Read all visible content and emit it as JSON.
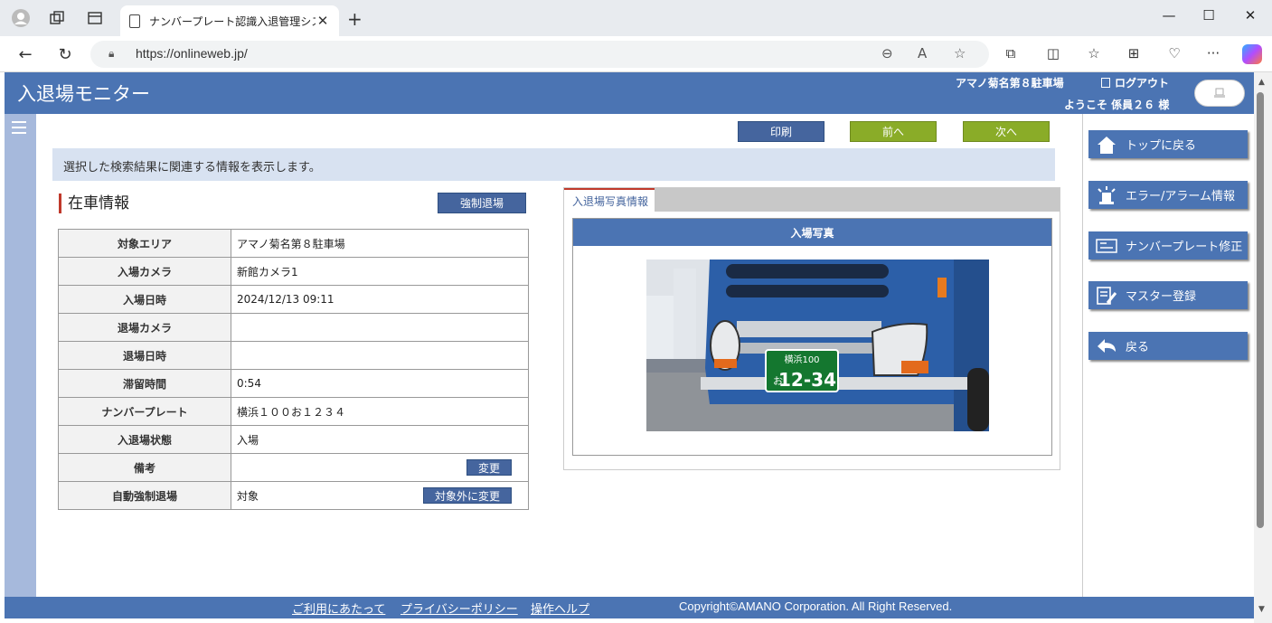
{
  "browser": {
    "tab_title": "ナンバープレート認識入退管理システム",
    "url": "https://onlineweb.jp/"
  },
  "header": {
    "title": "入退場モニター",
    "facility": "アマノ菊名第８駐車場",
    "logout": "ログアウト",
    "welcome": "ようこそ 係員２６ 様"
  },
  "toolbar": {
    "print": "印刷",
    "prev": "前へ",
    "next": "次へ"
  },
  "info_message": "選択した検索結果に関連する情報を表示します。",
  "section": {
    "title": "在車情報",
    "force_exit": "強制退場"
  },
  "rows": [
    {
      "label": "対象エリア",
      "value": "アマノ菊名第８駐車場"
    },
    {
      "label": "入場カメラ",
      "value": "新館カメラ1"
    },
    {
      "label": "入場日時",
      "value": "2024/12/13 09:11"
    },
    {
      "label": "退場カメラ",
      "value": ""
    },
    {
      "label": "退場日時",
      "value": ""
    },
    {
      "label": "滞留時間",
      "value": "0:54"
    },
    {
      "label": "ナンバープレート",
      "value": " 横浜１００お１２３４"
    },
    {
      "label": "入退場状態",
      "value": "入場"
    },
    {
      "label": "備考",
      "value": "",
      "button": "変更"
    },
    {
      "label": "自動強制退場",
      "value": "対象",
      "button": "対象外に変更"
    }
  ],
  "photo": {
    "tab": "入退場写真情報",
    "header": "入場写真",
    "plate_top": "横浜100",
    "plate_kana": "お",
    "plate_number": "12-34"
  },
  "sidebar": [
    {
      "label": "トップに戻る",
      "icon": "home-icon"
    },
    {
      "label": "エラー/アラーム情報",
      "icon": "alarm-icon"
    },
    {
      "label": "ナンバープレート修正",
      "icon": "plate-icon"
    },
    {
      "label": "マスター登録",
      "icon": "edit-icon"
    },
    {
      "label": "戻る",
      "icon": "back-icon"
    }
  ],
  "footer": {
    "terms": "ご利用にあたって",
    "privacy": "プライバシーポリシー",
    "help": "操作ヘルプ",
    "copyright": "Copyright©AMANO Corporation. All Right Reserved."
  }
}
